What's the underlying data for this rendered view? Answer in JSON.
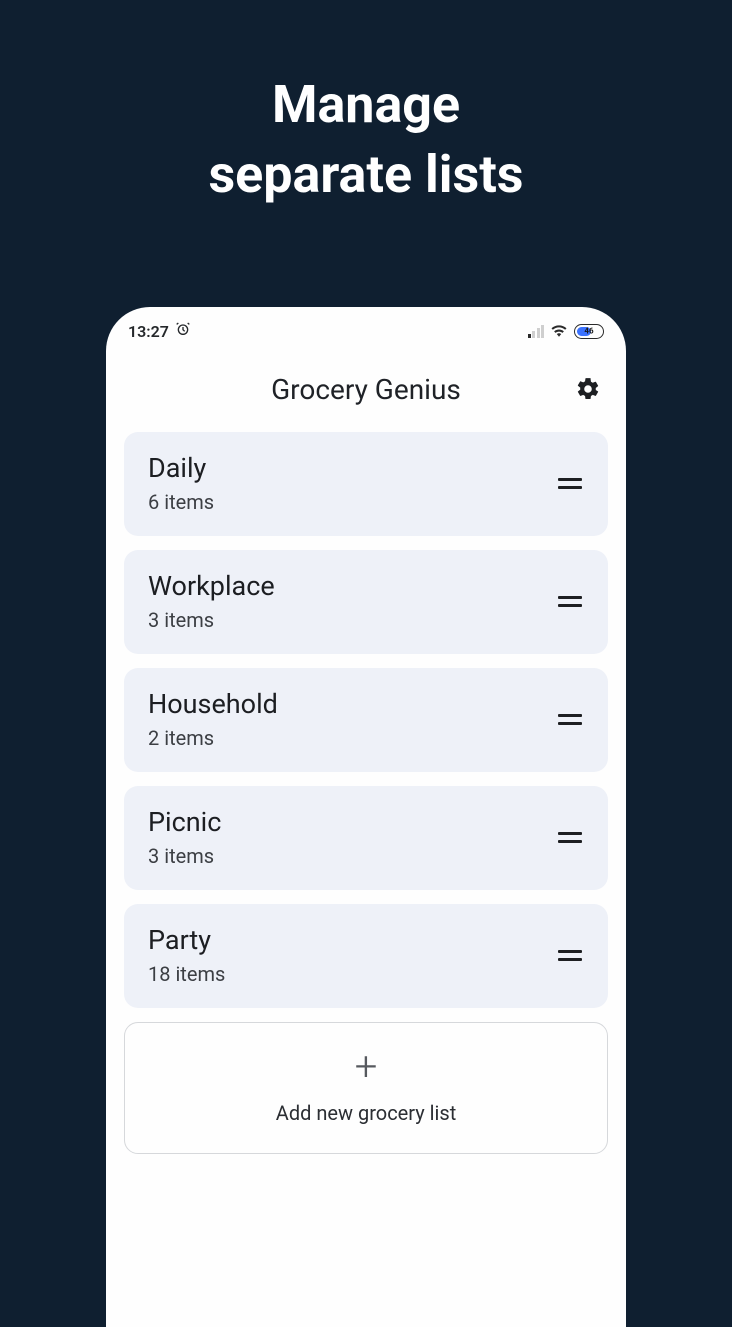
{
  "promo": {
    "headline_line1": "Manage",
    "headline_line2": "separate lists"
  },
  "status_bar": {
    "time": "13:27",
    "battery_level": "46"
  },
  "header": {
    "app_title": "Grocery Genius"
  },
  "lists": [
    {
      "name": "Daily",
      "count_label": "6 items"
    },
    {
      "name": "Workplace",
      "count_label": "3 items"
    },
    {
      "name": "Household",
      "count_label": "2 items"
    },
    {
      "name": "Picnic",
      "count_label": "3 items"
    },
    {
      "name": "Party",
      "count_label": "18 items"
    }
  ],
  "add_button": {
    "label": "Add new grocery list"
  }
}
